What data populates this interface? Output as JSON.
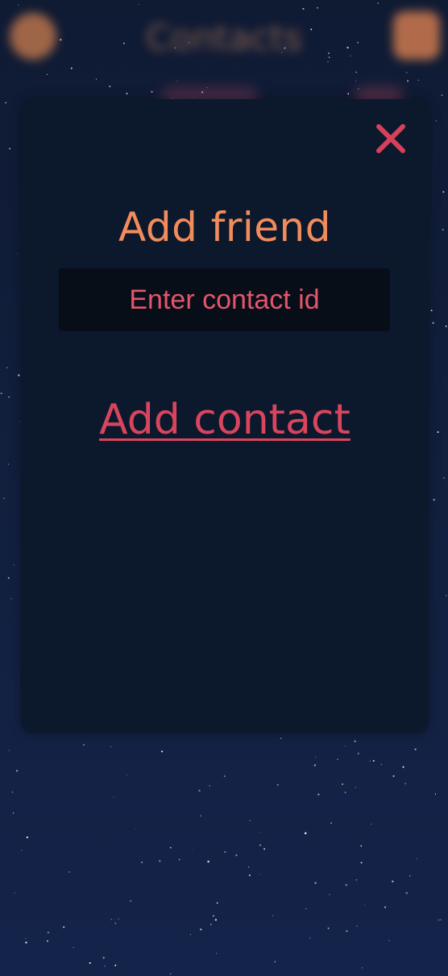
{
  "colors": {
    "background_top": "#0f1a33",
    "background_bottom": "#14234a",
    "modal_background": "#0c192d",
    "input_background": "#070e18",
    "title_orange": "#f28c5c",
    "accent_red": "#d9455d",
    "close_red": "#d8405a",
    "star": "#ffffff"
  },
  "header": {
    "title": "Contacts",
    "avatar_icon": "avatar",
    "menu_icon": "menu-icon"
  },
  "modal": {
    "close_icon": "close-icon",
    "title": "Add friend",
    "input": {
      "value": "",
      "placeholder": "Enter contact id"
    },
    "submit_label": "Add contact"
  }
}
